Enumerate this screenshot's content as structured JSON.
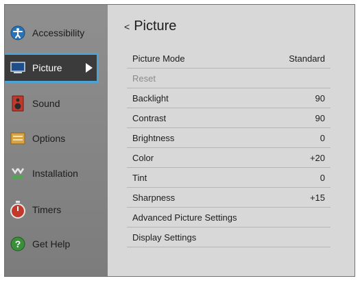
{
  "sidebar": {
    "items": [
      {
        "label": "Accessibility",
        "icon": "accessibility-icon"
      },
      {
        "label": "Picture",
        "icon": "tv-icon"
      },
      {
        "label": "Sound",
        "icon": "speaker-icon"
      },
      {
        "label": "Options",
        "icon": "options-icon"
      },
      {
        "label": "Installation",
        "icon": "installation-icon"
      },
      {
        "label": "Timers",
        "icon": "timer-icon"
      },
      {
        "label": "Get Help",
        "icon": "help-icon"
      }
    ],
    "selected": "Picture"
  },
  "main": {
    "back_glyph": "<",
    "title": "Picture",
    "rows": [
      {
        "label": "Picture Mode",
        "value": "Standard"
      },
      {
        "label": "Reset",
        "value": ""
      },
      {
        "label": "Backlight",
        "value": "90"
      },
      {
        "label": "Contrast",
        "value": "90"
      },
      {
        "label": "Brightness",
        "value": "0"
      },
      {
        "label": "Color",
        "value": "+20"
      },
      {
        "label": "Tint",
        "value": "0"
      },
      {
        "label": "Sharpness",
        "value": "+15"
      },
      {
        "label": "Advanced Picture Settings",
        "value": ""
      },
      {
        "label": "Display Settings",
        "value": ""
      }
    ]
  },
  "colors": {
    "selection_border": "#4aa5d6",
    "accessibility_icon": "#2b73b8",
    "sound_icon": "#c0392b",
    "help_icon": "#3a8f3a",
    "timer_icon": "#c0392b"
  }
}
